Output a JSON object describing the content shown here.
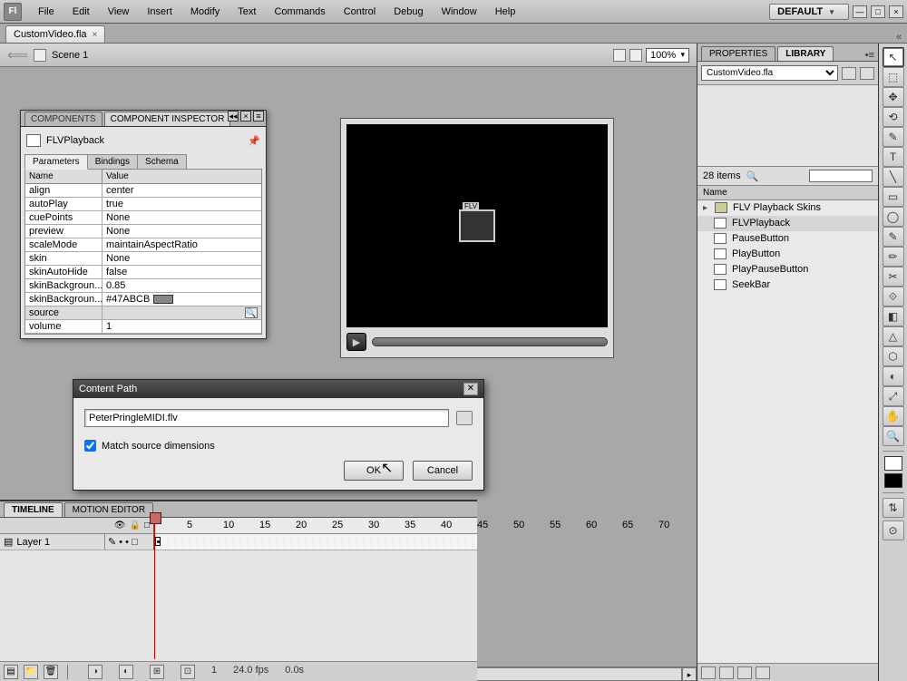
{
  "menubar": {
    "items": [
      "File",
      "Edit",
      "View",
      "Insert",
      "Modify",
      "Text",
      "Commands",
      "Control",
      "Debug",
      "Window",
      "Help"
    ],
    "workspace": "DEFAULT"
  },
  "document": {
    "tab": "CustomVideo.fla"
  },
  "editbar": {
    "scene": "Scene 1",
    "zoom": "100%"
  },
  "componentInspector": {
    "tabs": {
      "inactive": "COMPONENTS",
      "active": "COMPONENT INSPECTOR"
    },
    "instance": "FLVPlayback",
    "subtabs": [
      "Parameters",
      "Bindings",
      "Schema"
    ],
    "columns": {
      "name": "Name",
      "value": "Value"
    },
    "params": [
      {
        "name": "align",
        "value": "center"
      },
      {
        "name": "autoPlay",
        "value": "true"
      },
      {
        "name": "cuePoints",
        "value": "None"
      },
      {
        "name": "preview",
        "value": "None"
      },
      {
        "name": "scaleMode",
        "value": "maintainAspectRatio"
      },
      {
        "name": "skin",
        "value": "None"
      },
      {
        "name": "skinAutoHide",
        "value": "false"
      },
      {
        "name": "skinBackgroun...",
        "value": "0.85"
      },
      {
        "name": "skinBackgroun...",
        "value": "#47ABCB"
      },
      {
        "name": "source",
        "value": ""
      },
      {
        "name": "volume",
        "value": "1"
      }
    ]
  },
  "dialog": {
    "title": "Content Path",
    "path": "PeterPringleMIDI.flv",
    "checkbox": "Match source dimensions",
    "ok": "OK",
    "cancel": "Cancel"
  },
  "library": {
    "tabs": {
      "props": "PROPERTIES",
      "lib": "LIBRARY"
    },
    "doc": "CustomVideo.fla",
    "count": "28 items",
    "header": "Name",
    "items": [
      {
        "label": "FLV Playback Skins",
        "folder": true
      },
      {
        "label": "FLVPlayback",
        "sel": true
      },
      {
        "label": "PauseButton"
      },
      {
        "label": "PlayButton"
      },
      {
        "label": "PlayPauseButton"
      },
      {
        "label": "SeekBar"
      }
    ]
  },
  "timeline": {
    "tabs": {
      "tl": "TIMELINE",
      "me": "MOTION EDITOR"
    },
    "layer": "Layer 1",
    "frame": "1",
    "fps": "24.0 fps",
    "time": "0.0s",
    "ticks": [
      5,
      10,
      15,
      20,
      25,
      30,
      35,
      40,
      45,
      50,
      55,
      60,
      65,
      70
    ]
  },
  "tools": [
    "↖",
    "⬚",
    "✥",
    "⟲",
    "✎",
    "T",
    "╲",
    "▭",
    "◯",
    "✎",
    "✏",
    "✂",
    "⟐",
    "◧",
    "△",
    "⬡",
    "◐",
    "⤢",
    "✋",
    "🔍"
  ]
}
